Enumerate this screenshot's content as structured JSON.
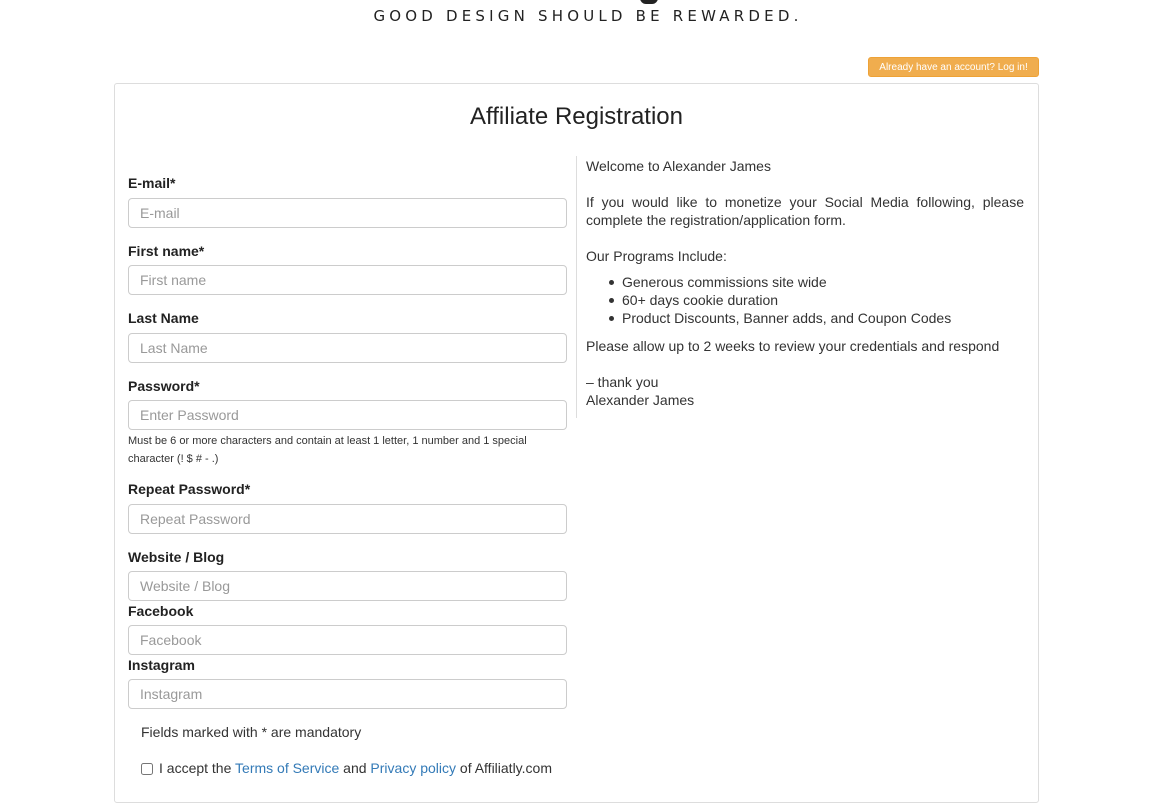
{
  "header": {
    "tagline": "GOOD DESIGN SHOULD BE REWARDED.",
    "login_link": "Already have an account? Log in!"
  },
  "title": "Affiliate Registration",
  "form": {
    "email": {
      "label": "E-mail*",
      "placeholder": "E-mail"
    },
    "first_name": {
      "label": "First name*",
      "placeholder": "First name"
    },
    "last_name": {
      "label": "Last Name",
      "placeholder": "Last Name"
    },
    "password": {
      "label": "Password*",
      "placeholder": "Enter Password",
      "hint": "Must be 6 or more characters and contain at least 1 letter, 1 number and 1 special character (! $ # - .)"
    },
    "repeat_password": {
      "label": "Repeat Password*",
      "placeholder": "Repeat Password"
    },
    "website": {
      "label": "Website / Blog",
      "placeholder": "Website / Blog"
    },
    "facebook": {
      "label": "Facebook",
      "placeholder": "Facebook"
    },
    "instagram": {
      "label": "Instagram",
      "placeholder": "Instagram"
    },
    "mandatory_note": "Fields marked with * are mandatory",
    "terms": {
      "prefix": "I accept the",
      "tos_link": "Terms of Service",
      "and": "and",
      "privacy_link": "Privacy policy",
      "suffix": "of Affiliatly.com"
    }
  },
  "info": {
    "welcome": "Welcome to Alexander James",
    "intro": "If you would like to monetize your Social Media following, please complete the registration/application form.",
    "programs_heading": "Our Programs Include:",
    "programs": [
      "Generous commissions site wide",
      "60+ days cookie duration",
      "Product Discounts, Banner adds, and Coupon Codes"
    ],
    "review_note": "Please allow up to 2 weeks to review your credentials and respond",
    "thanks": "– thank you",
    "signature": "Alexander James"
  }
}
